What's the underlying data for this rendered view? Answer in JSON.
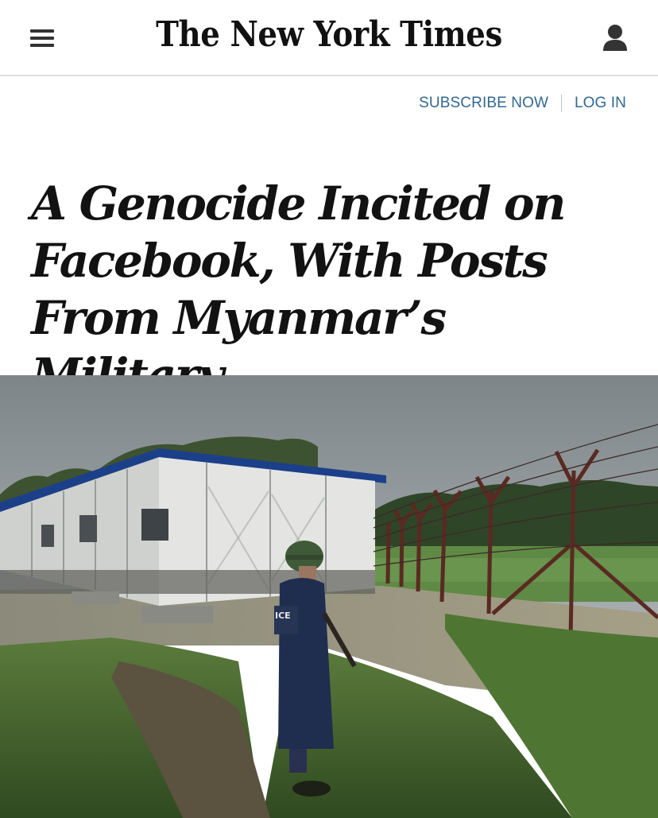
{
  "header": {
    "logo_text": "The New York Times",
    "menu_icon": "hamburger-menu-icon",
    "user_icon": "user-account-icon"
  },
  "account": {
    "subscribe_label": "SUBSCRIBE NOW",
    "login_label": "LOG IN",
    "link_color": "#326891"
  },
  "article": {
    "headline": "A Genocide Incited on Facebook, With Posts From Myanmar’s Military",
    "photo": {
      "vest_text": "ICE"
    }
  }
}
